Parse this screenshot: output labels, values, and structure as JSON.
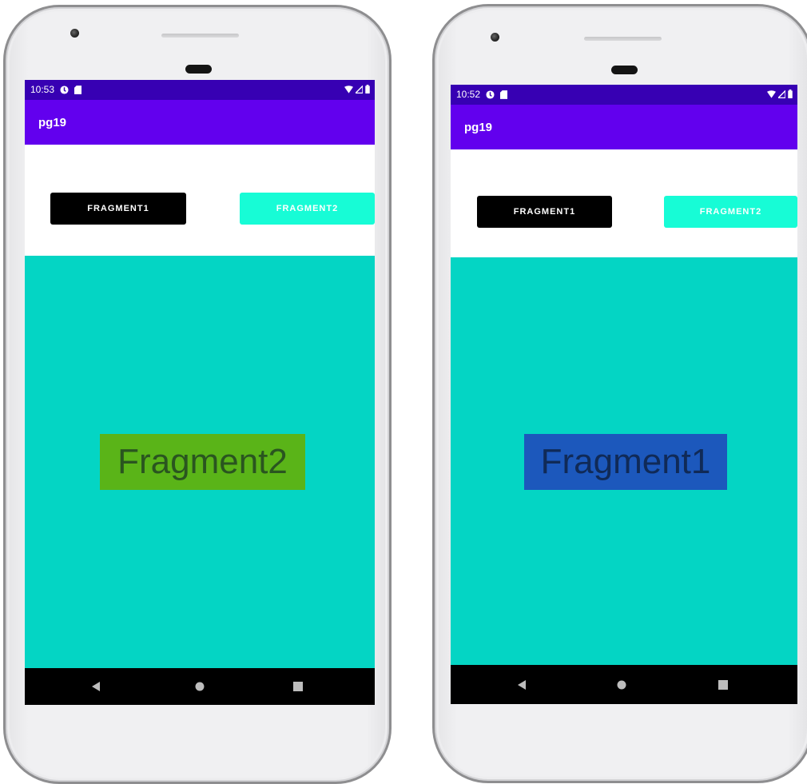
{
  "devices": [
    {
      "status_time": "10:53",
      "app_title": "pg19",
      "button1_label": "FRAGMENT1",
      "button2_label": "FRAGMENT2",
      "fragment_text": "Fragment2",
      "fragment_bg_color": "#5ab418"
    },
    {
      "status_time": "10:52",
      "app_title": "pg19",
      "button1_label": "FRAGMENT1",
      "button2_label": "FRAGMENT2",
      "fragment_text": "Fragment1",
      "fragment_bg_color": "#1c58bc"
    }
  ],
  "colors": {
    "status_bar": "#3700b3",
    "app_bar": "#6200ee",
    "fragment_container": "#04d5c4",
    "button1": "#000000",
    "button2": "#17fcd6"
  },
  "icons": {
    "status_left": [
      "sync-icon",
      "sd-card-icon"
    ],
    "status_right": [
      "wifi-icon",
      "signal-icon",
      "battery-icon"
    ],
    "nav": [
      "back-icon",
      "home-icon",
      "recents-icon"
    ]
  }
}
